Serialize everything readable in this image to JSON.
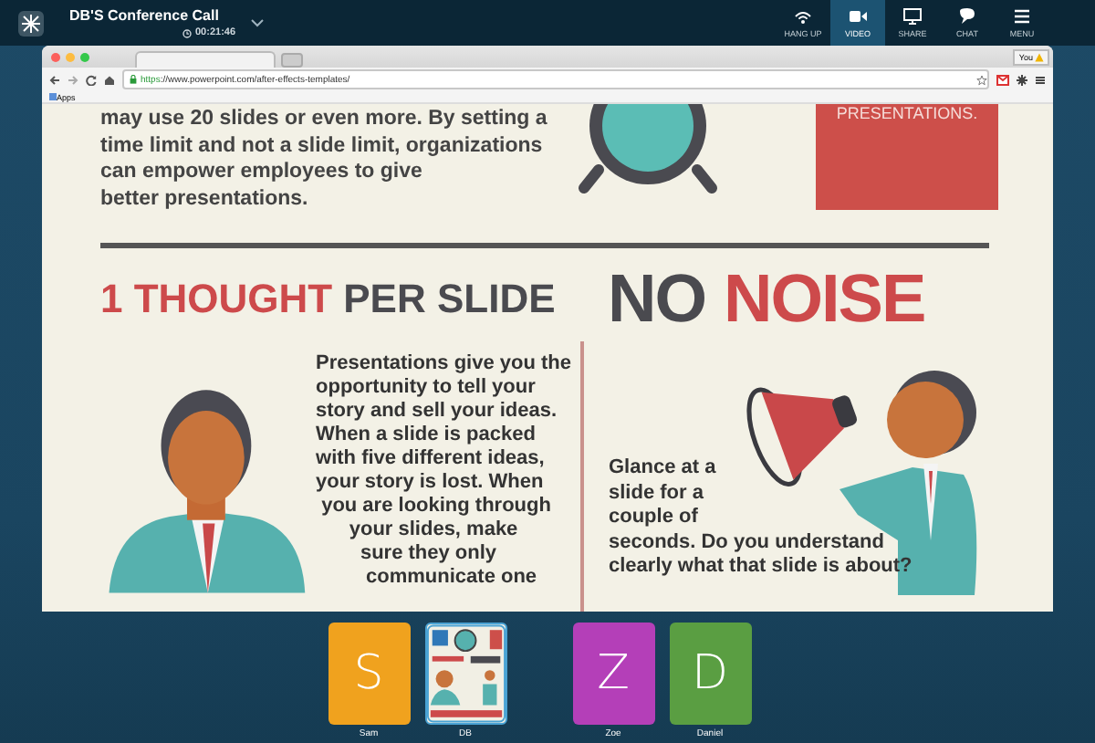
{
  "call": {
    "title": "DB'S Conference Call",
    "timer": "00:21:46"
  },
  "call_controls": [
    {
      "kind": "hangup",
      "label": "HANG UP",
      "selected": false
    },
    {
      "kind": "video",
      "label": "VIDEO",
      "selected": true
    },
    {
      "kind": "share",
      "label": "SHARE",
      "selected": false
    },
    {
      "kind": "chat",
      "label": "CHAT",
      "selected": false
    },
    {
      "kind": "menu",
      "label": "MENU",
      "selected": false
    }
  ],
  "browser": {
    "profile": "You",
    "url_scheme": "https",
    "url_rest": "://www.powerpoint.com/after-effects-templates/",
    "bookmarks": [
      "Apps"
    ]
  },
  "slide": {
    "intro": "may use 20 slides or even more. By setting a\ntime limit and not a slide limit, organizations\ncan empower employees to give\nbetter presentations.",
    "banner": "PRESENTATIONS.",
    "left_heading": [
      {
        "text": "1 THOUGHT",
        "color": "#cd4a4b"
      },
      {
        "text": "PER SLIDE",
        "color": "#4a4a4f"
      }
    ],
    "left_body": "Presentations give you the\nopportunity to tell your\nstory and sell your ideas.\nWhen a slide is packed\nwith five different ideas,\nyour story is lost. When\n you are looking through\n      your slides, make\n        sure they only\n         communicate one",
    "right_heading": [
      {
        "text": "NO",
        "color": "#4a4a4f"
      },
      {
        "text": "NOISE",
        "color": "#cd4a4b"
      }
    ],
    "right_body": "Glance at a\nslide for a\ncouple of\nseconds. Do you understand\nclearly what that slide is about?"
  },
  "participants": [
    {
      "kind": "letter",
      "initial": "S",
      "name": "Sam",
      "color": "#f0a21e"
    },
    {
      "kind": "screen",
      "name": "DB"
    },
    {
      "kind": "letter",
      "initial": "Z",
      "name": "Zoe",
      "color": "#b43fb8"
    },
    {
      "kind": "letter",
      "initial": "D",
      "name": "Daniel",
      "color": "#5a9e42"
    }
  ]
}
